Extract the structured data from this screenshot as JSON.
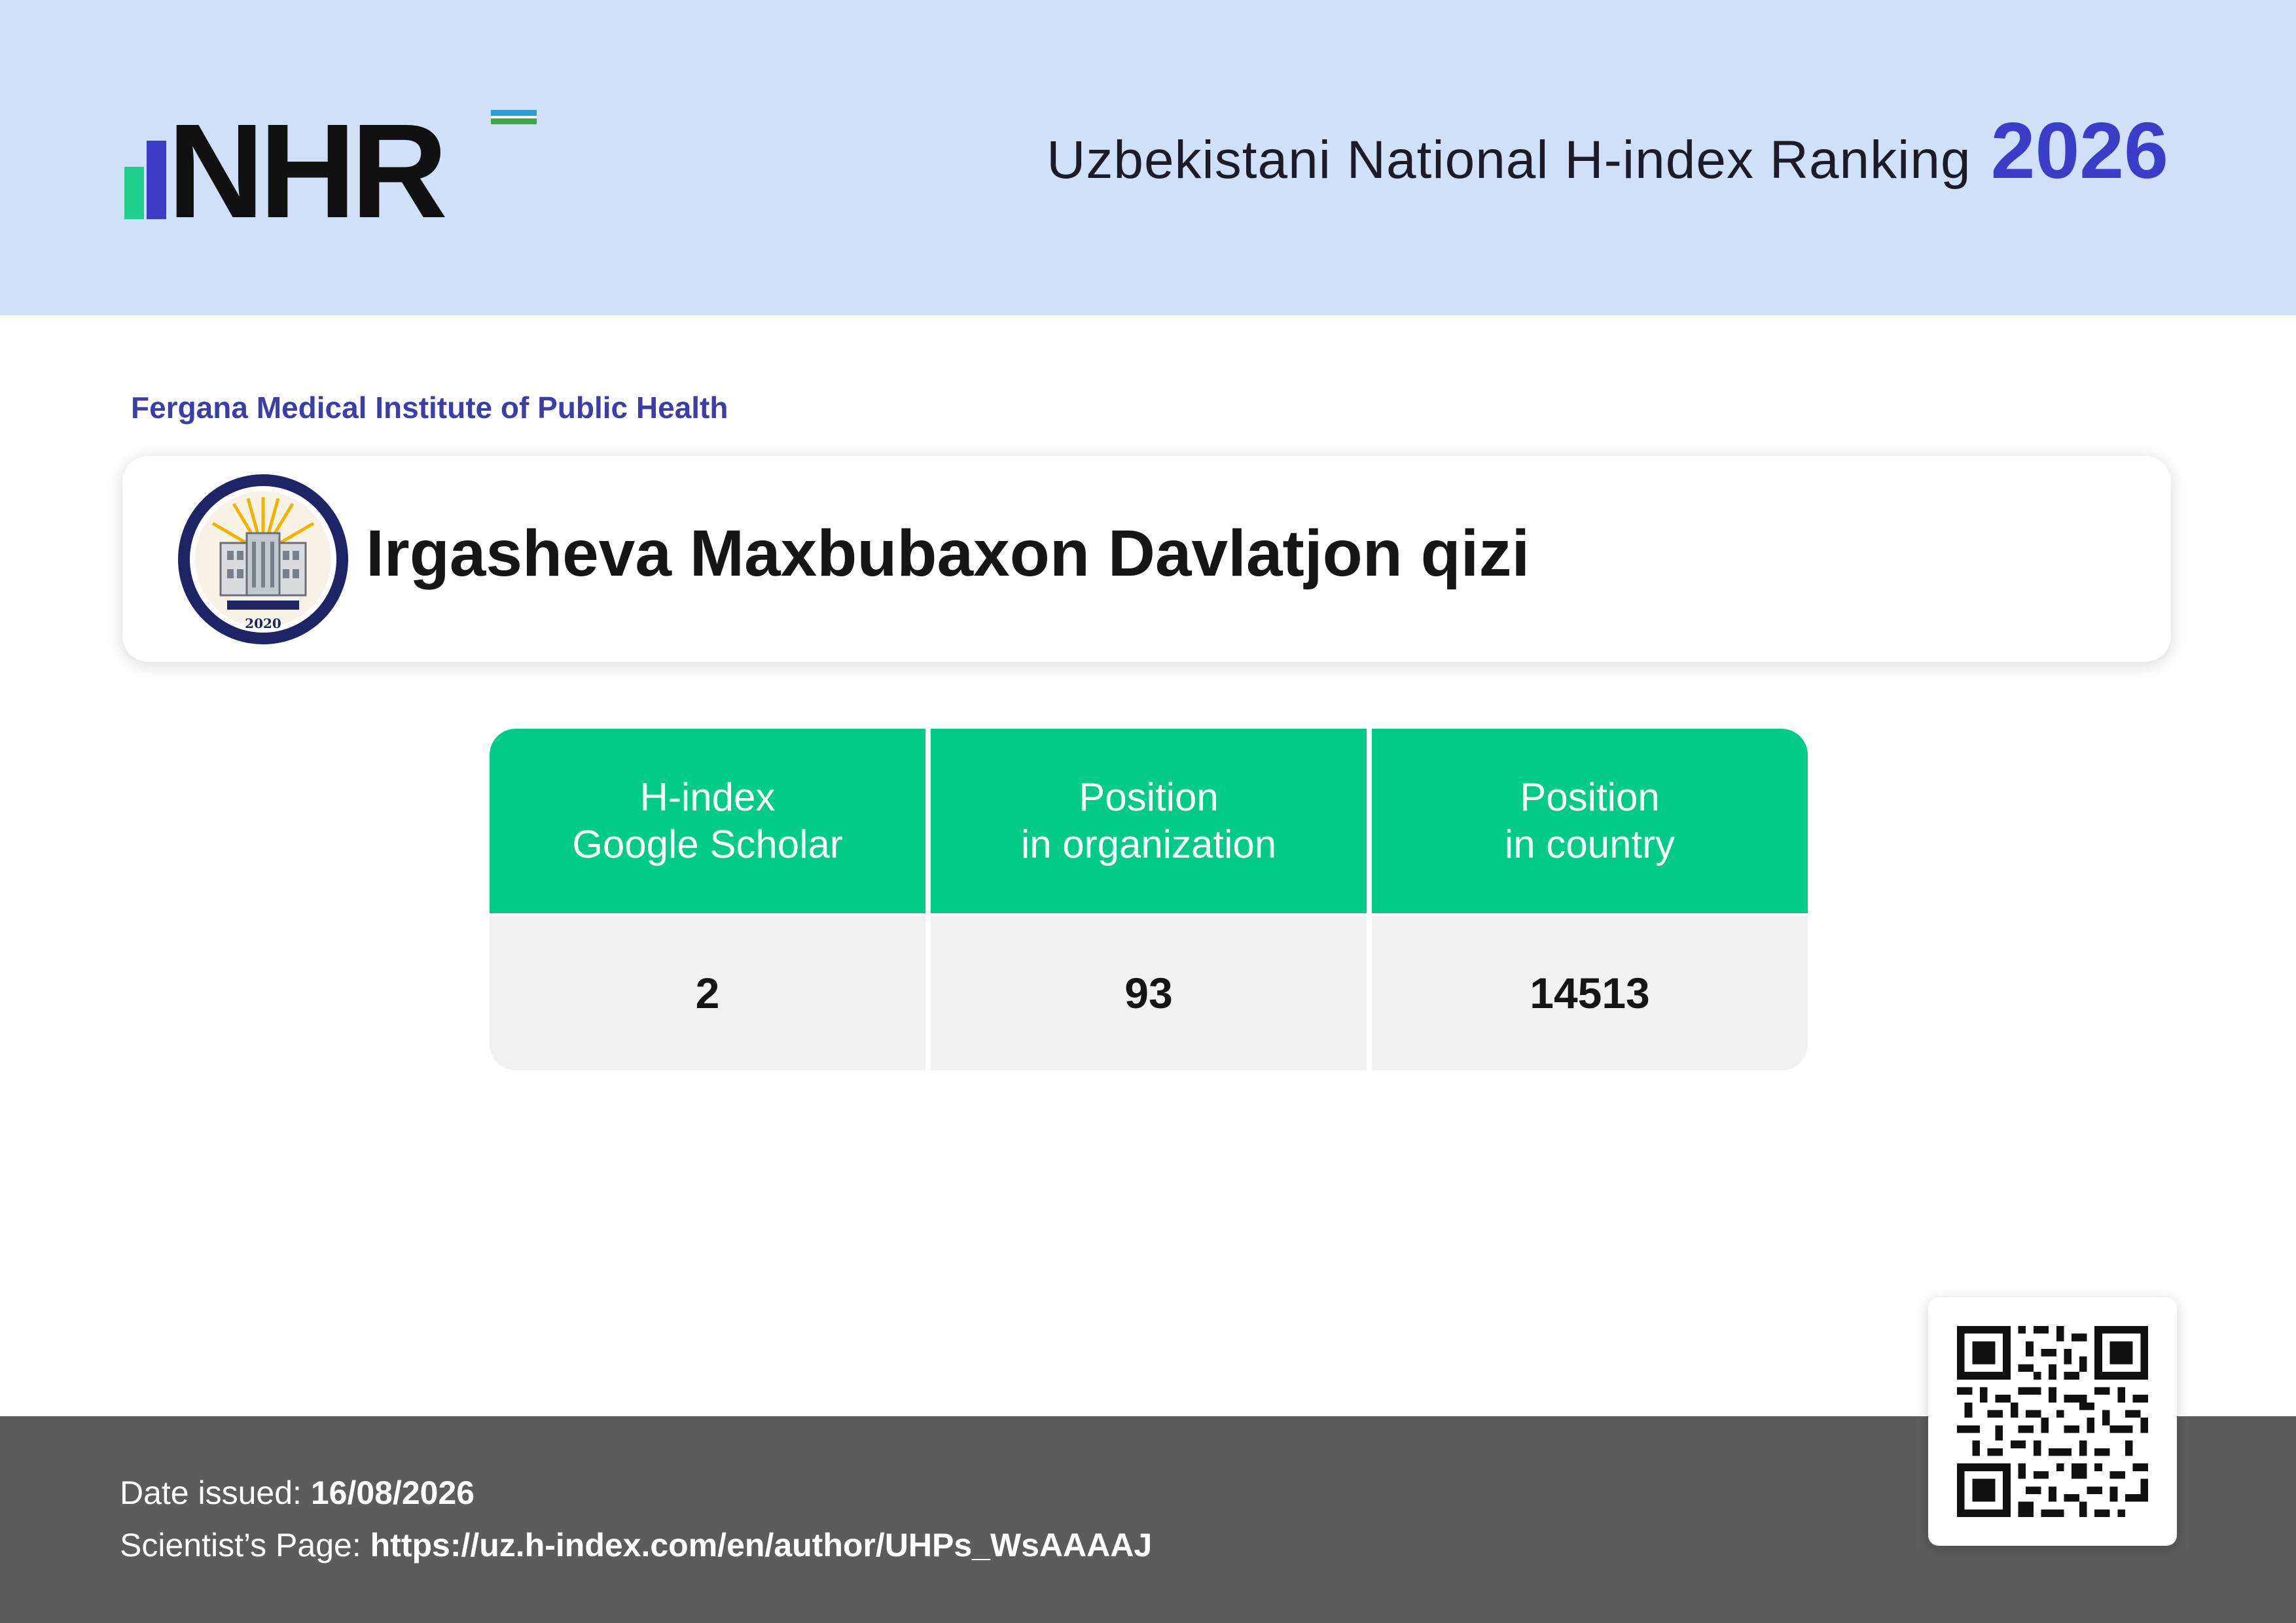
{
  "header": {
    "logo_text": "NHR",
    "ranking_title": "Uzbekistani National H-index Ranking",
    "year": "2026"
  },
  "organization": {
    "name": "Fergana Medical Institute of Public Health",
    "emblem_year": "2020"
  },
  "scientist": {
    "name": "Irgasheva Maxbubaxon Davlatjon qizi"
  },
  "metrics": [
    {
      "header_line1": "H-index",
      "header_line2": "Google Scholar",
      "value": "2"
    },
    {
      "header_line1": "Position",
      "header_line2": "in organization",
      "value": "93"
    },
    {
      "header_line1": "Position",
      "header_line2": "in country",
      "value": "14513"
    }
  ],
  "footer": {
    "date_label": "Date issued:",
    "date_value": "16/08/2026",
    "page_label": "Scientist’s Page:",
    "page_url": "https://uz.h-index.com/en/author/UHPs_WsAAAAJ"
  },
  "colors": {
    "header_band": "#cfe0f8",
    "accent_blue": "#3a3dc8",
    "table_green": "#00cc88",
    "footer_gray": "#5c5c5c"
  }
}
